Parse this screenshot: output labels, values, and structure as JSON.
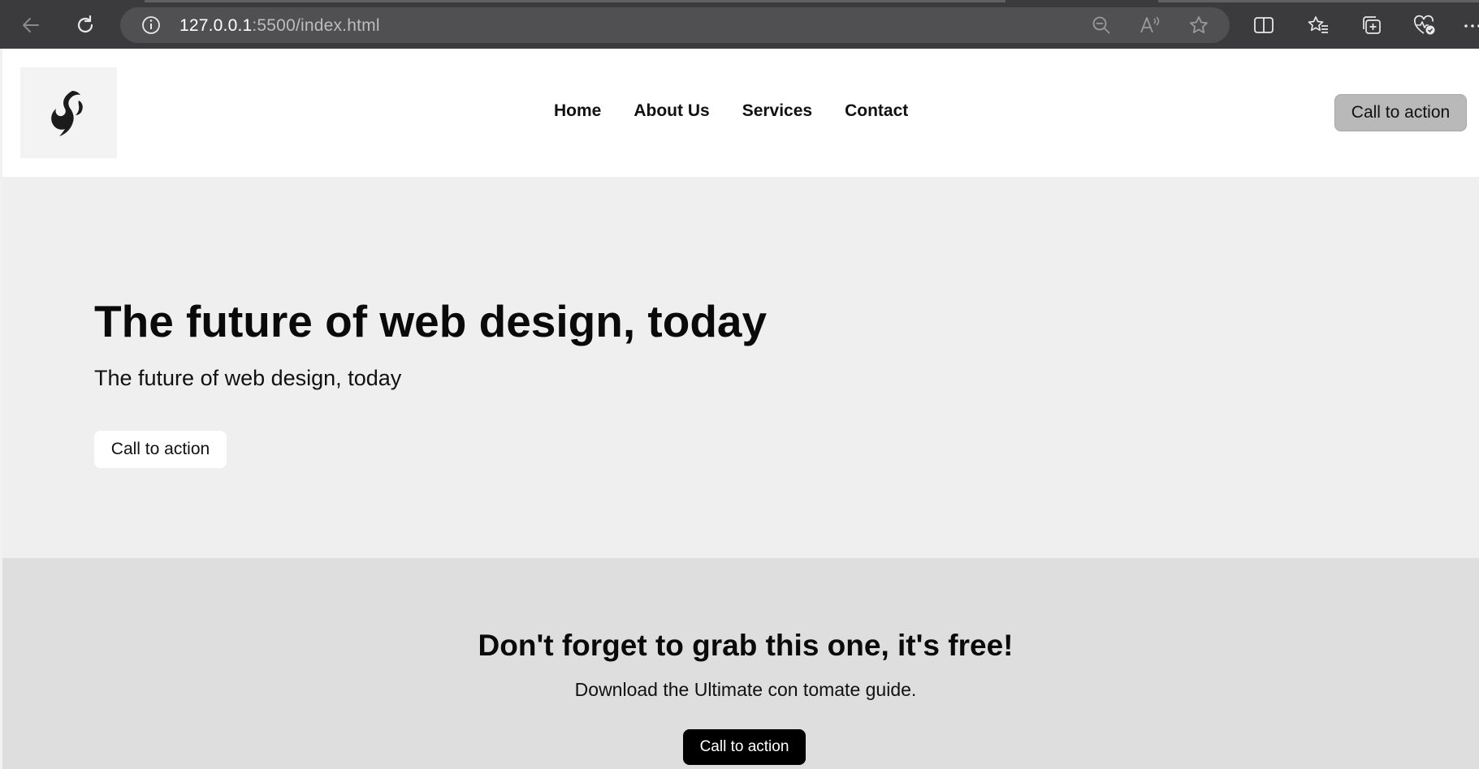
{
  "browser": {
    "url_host": "127.0.0.1",
    "url_rest": ":5500/index.html",
    "icons": [
      "back-arrow-icon",
      "refresh-icon",
      "info-icon",
      "zoom-out-icon",
      "read-aloud-icon",
      "favorite-star-icon",
      "split-screen-icon",
      "favorites-icon",
      "collections-icon",
      "browser-essentials-icon",
      "more-icon"
    ]
  },
  "header": {
    "logo": "bird-flame-logo",
    "nav": [
      "Home",
      "About Us",
      "Services",
      "Contact"
    ],
    "cta_label": "Call to action"
  },
  "hero": {
    "title": "The future of web design, today",
    "subtitle": "The future of web design, today",
    "cta_label": "Call to action"
  },
  "promo": {
    "title": "Don't forget to grab this one, it's free!",
    "text": "Download the Ultimate con tomate guide.",
    "cta_label": "Call to action"
  },
  "colors": {
    "chrome": "#3b3b3d",
    "address_bar": "#505053",
    "header_cta": "#b9b9b9",
    "hero_bg": "#efefef",
    "promo_bg": "#dedede",
    "promo_cta": "#000000"
  }
}
